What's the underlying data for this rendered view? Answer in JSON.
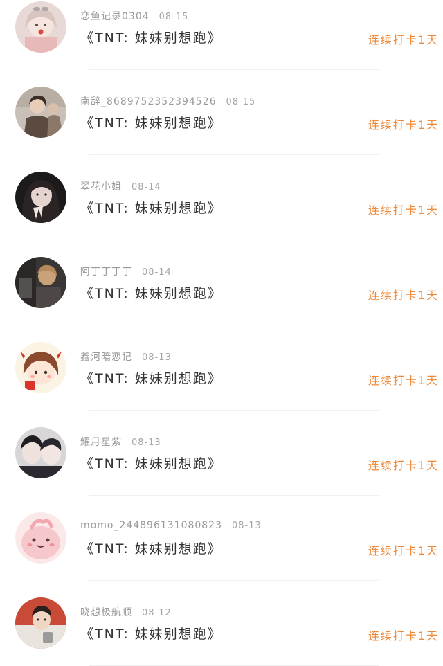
{
  "checkins": [
    {
      "username": "恋鱼记录0304",
      "date": "08-15",
      "title": "《TNT: 妹妹别想跑》",
      "streak": "连续打卡1天",
      "avatar_icon": "user-avatar"
    },
    {
      "username": "南辞_8689752352394526",
      "date": "08-15",
      "title": "《TNT: 妹妹别想跑》",
      "streak": "连续打卡1天",
      "avatar_icon": "user-avatar"
    },
    {
      "username": "翠花小姐",
      "date": "08-14",
      "title": "《TNT: 妹妹别想跑》",
      "streak": "连续打卡1天",
      "avatar_icon": "user-avatar"
    },
    {
      "username": "阿丁丁丁丁",
      "date": "08-14",
      "title": "《TNT: 妹妹别想跑》",
      "streak": "连续打卡1天",
      "avatar_icon": "user-avatar"
    },
    {
      "username": "鑫河暗恋记",
      "date": "08-13",
      "title": "《TNT: 妹妹别想跑》",
      "streak": "连续打卡1天",
      "avatar_icon": "user-avatar"
    },
    {
      "username": "耀月星紫",
      "date": "08-13",
      "title": "《TNT: 妹妹别想跑》",
      "streak": "连续打卡1天",
      "avatar_icon": "user-avatar"
    },
    {
      "username": "momo_244896131080823",
      "date": "08-13",
      "title": "《TNT: 妹妹别想跑》",
      "streak": "连续打卡1天",
      "avatar_icon": "user-avatar"
    },
    {
      "username": "晓想极航顺",
      "date": "08-12",
      "title": "《TNT: 妹妹别想跑》",
      "streak": "连续打卡1天",
      "avatar_icon": "user-avatar"
    }
  ],
  "colors": {
    "streak": "#ef8a3b",
    "title": "#333333",
    "meta": "#9a9a9a"
  }
}
